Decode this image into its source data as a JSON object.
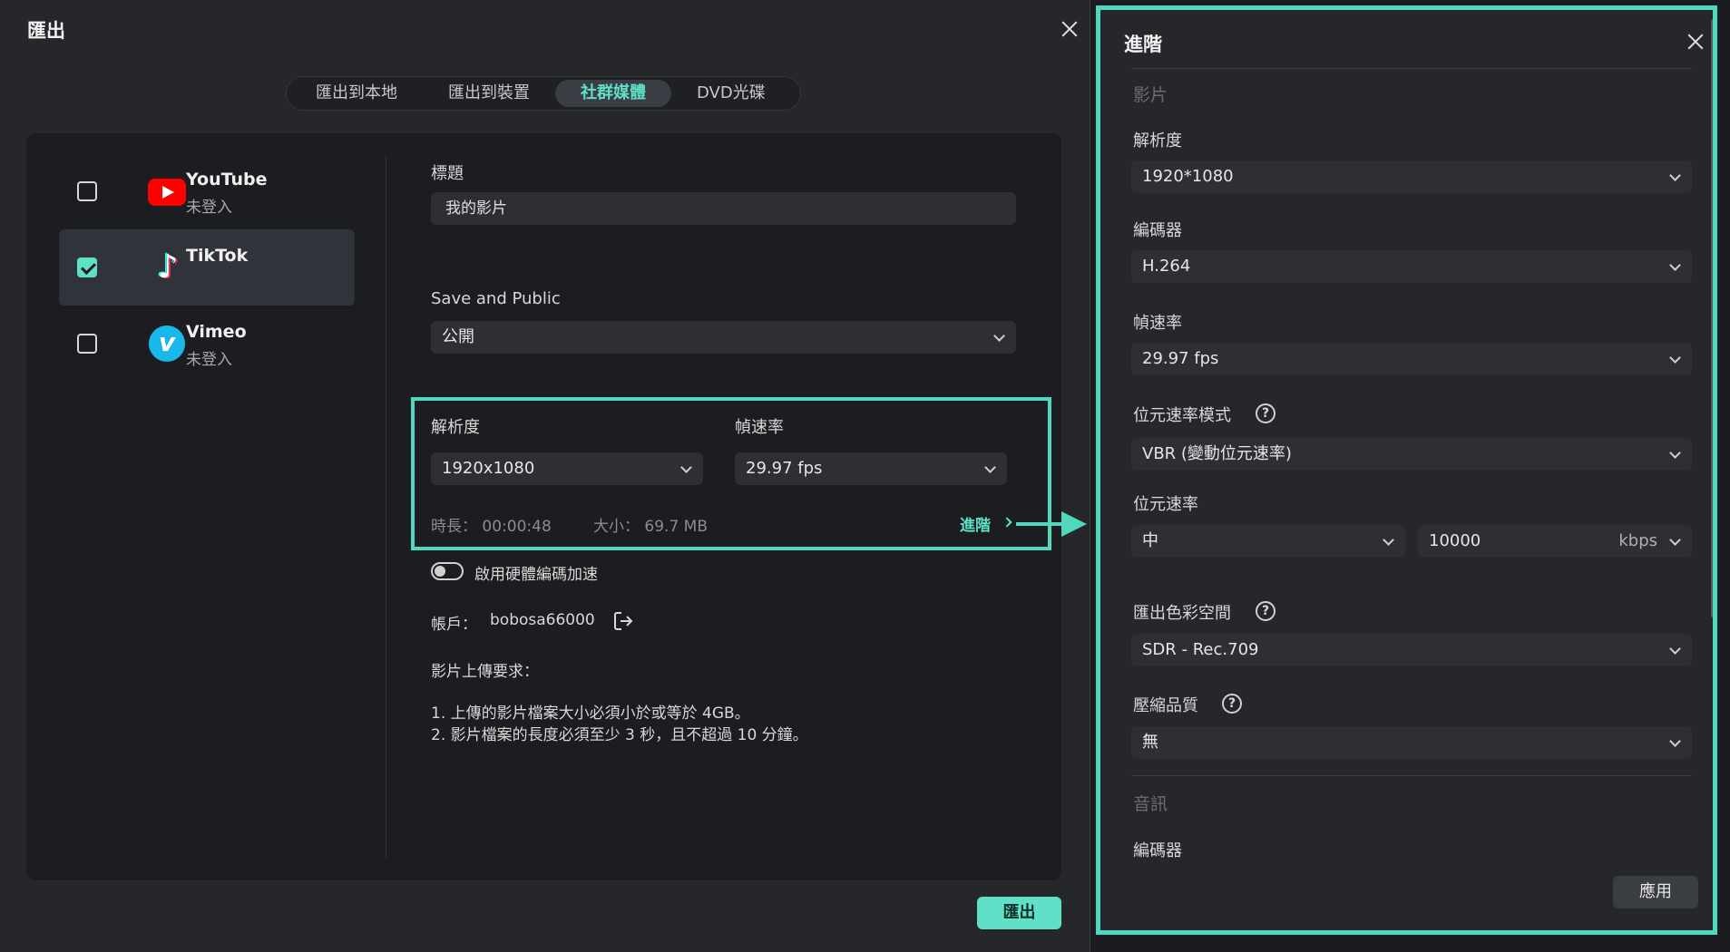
{
  "export_dialog": {
    "title": "匯出",
    "tabs": [
      {
        "label": "匯出到本地",
        "active": false
      },
      {
        "label": "匯出到裝置",
        "active": false
      },
      {
        "label": "社群媒體",
        "active": true
      },
      {
        "label": "DVD光碟",
        "active": false
      }
    ],
    "platforms": [
      {
        "name": "YouTube",
        "status": "未登入",
        "checked": false,
        "selected": false,
        "icon": "youtube-logo"
      },
      {
        "name": "TikTok",
        "status": "",
        "checked": true,
        "selected": true,
        "icon": "tiktok-logo"
      },
      {
        "name": "Vimeo",
        "status": "未登入",
        "checked": false,
        "selected": false,
        "icon": "vimeo-logo"
      }
    ],
    "form": {
      "title_label": "標題",
      "title_value": "我的影片",
      "privacy_label": "Save and Public",
      "privacy_value": "公開",
      "resolution_label": "解析度",
      "resolution_value": "1920x1080",
      "framerate_label": "幀速率",
      "framerate_value": "29.97 fps",
      "duration_text": "時長： 00:00:48",
      "size_text": "大小： 69.7 MB",
      "advanced_link": "進階",
      "hw_accel_label": "啟用硬體編碼加速",
      "hw_accel_on": false,
      "account_label": "帳戶：",
      "account_value": "bobosa66000",
      "requirements_title": "影片上傳要求：",
      "requirements": [
        "1. 上傳的影片檔案大小必須小於或等於 4GB。",
        "2. 影片檔案的長度必須至少 3 秒，且不超過 10 分鐘。"
      ]
    },
    "export_button": "匯出",
    "accent_color": "#5fe0c7"
  },
  "advanced_panel": {
    "title": "進階",
    "video_section": "影片",
    "resolution_label": "解析度",
    "resolution_value": "1920*1080",
    "encoder_label": "編碼器",
    "encoder_value": "H.264",
    "framerate_label": "幀速率",
    "framerate_value": "29.97 fps",
    "bitrate_mode_label": "位元速率模式",
    "bitrate_mode_value": "VBR (變動位元速率)",
    "bitrate_label": "位元速率",
    "bitrate_level": "中",
    "bitrate_value": "10000",
    "bitrate_unit": "kbps",
    "color_space_label": "匯出色彩空間",
    "color_space_value": "SDR - Rec.709",
    "compression_label": "壓縮品質",
    "compression_value": "無",
    "audio_section": "音訊",
    "audio_encoder_label": "編碼器",
    "apply_button": "應用",
    "help_glyph": "?",
    "highlight_color": "#4fd8bd"
  }
}
